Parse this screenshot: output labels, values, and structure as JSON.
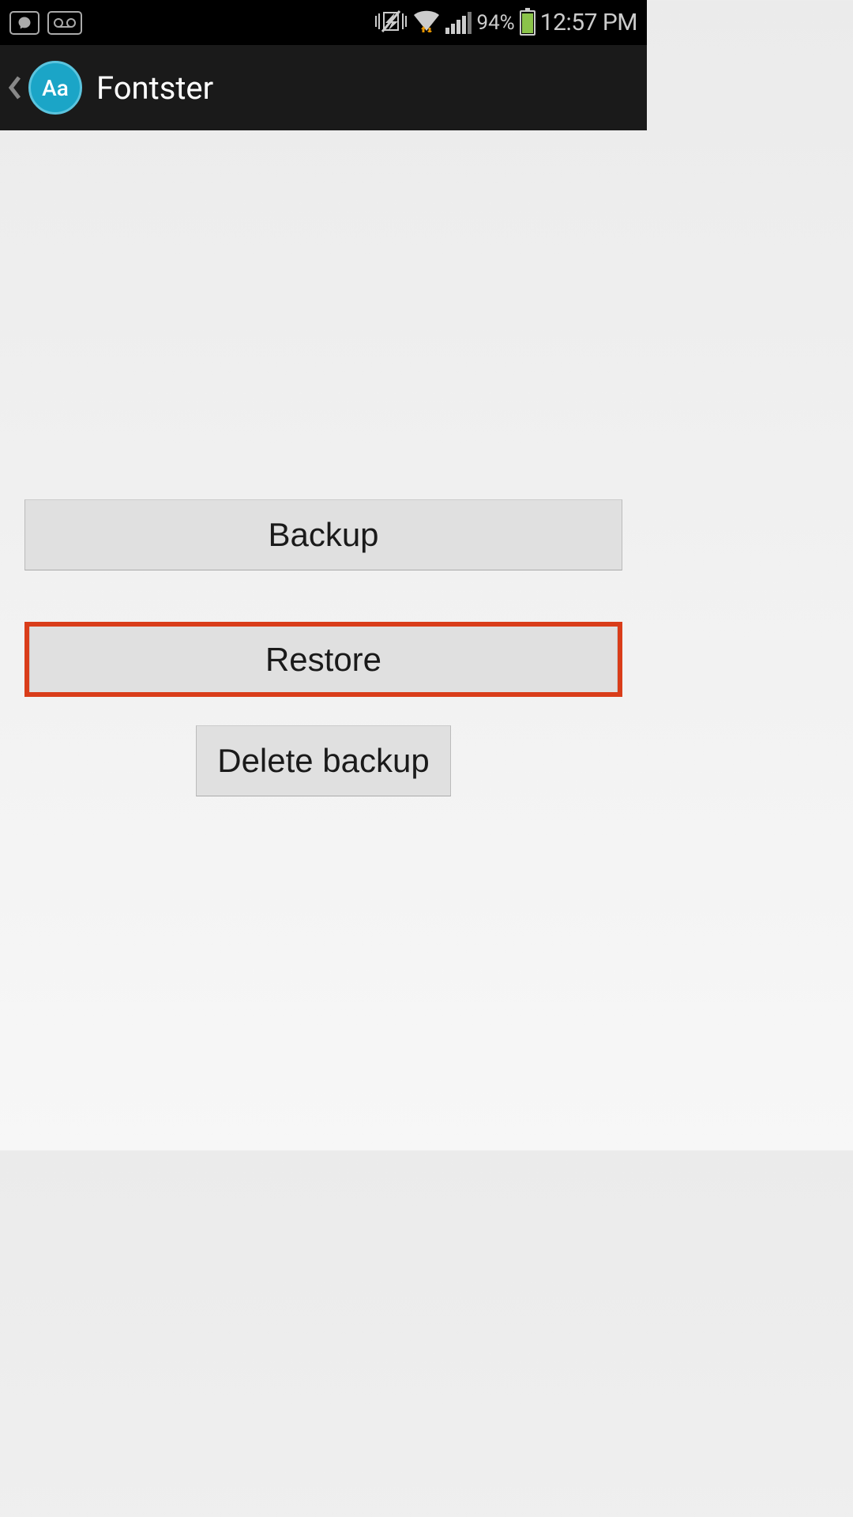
{
  "status_bar": {
    "battery_pct": "94%",
    "time": "12:57 PM"
  },
  "app_bar": {
    "icon_text": "Aa",
    "title": "Fontster"
  },
  "buttons": {
    "backup": "Backup",
    "restore": "Restore",
    "delete": "Delete backup"
  }
}
